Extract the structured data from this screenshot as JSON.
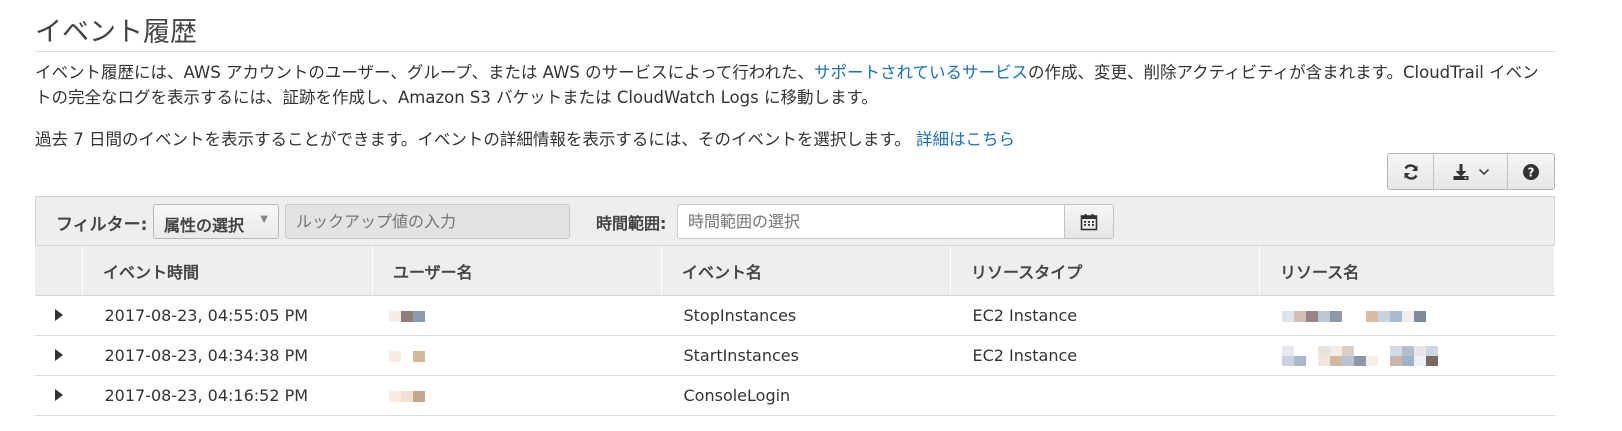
{
  "page": {
    "title": "イベント履歴",
    "desc_part1": "イベント履歴には、AWS アカウントのユーザー、グループ、または AWS のサービスによって行われた、",
    "desc_link": "サポートされているサービス",
    "desc_part2": "の作成、変更、削除アクティビティが含まれます。CloudTrail イベントの完全なログを表示するには、証跡を作成し、Amazon S3 バケットまたは CloudWatch Logs に移動します。",
    "desc2_text": "過去 7 日間のイベントを表示することができます。イベントの詳細情報を表示するには、そのイベントを選択します。",
    "desc2_link": "詳細はこちら"
  },
  "toolbar": {
    "refresh_icon": "refresh-icon",
    "download_icon": "download-icon",
    "help_icon": "help-icon"
  },
  "filter": {
    "label": "フィルター:",
    "attribute_select": "属性の選択",
    "lookup_placeholder": "ルックアップ値の入力",
    "time_label": "時間範囲:",
    "time_placeholder": "時間範囲の選択"
  },
  "table": {
    "headers": [
      "",
      "イベント時間",
      "ユーザー名",
      "イベント名",
      "リソースタイプ",
      "リソース名"
    ],
    "rows": [
      {
        "time": "2017-08-23, 04:55:05 PM",
        "user": "",
        "event": "StopInstances",
        "resource_type": "EC2 Instance",
        "resource_name": ""
      },
      {
        "time": "2017-08-23, 04:34:38 PM",
        "user": "",
        "event": "StartInstances",
        "resource_type": "EC2 Instance",
        "resource_name": ""
      },
      {
        "time": "2017-08-23, 04:16:52 PM",
        "user": "",
        "event": "ConsoleLogin",
        "resource_type": "",
        "resource_name": ""
      }
    ]
  },
  "colors": {
    "link": "#1a6fc2",
    "header_bg": "#eeeeee"
  }
}
